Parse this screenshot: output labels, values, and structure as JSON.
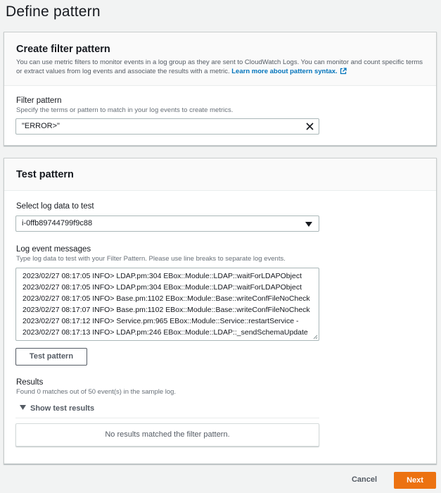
{
  "page": {
    "title": "Define pattern"
  },
  "create_panel": {
    "title": "Create filter pattern",
    "description": "You can use metric filters to monitor events in a log group as they are sent to CloudWatch Logs. You can monitor and count specific terms or extract values from log events and associate the results with a metric.",
    "learn_more": "Learn more about pattern syntax.",
    "filter_label": "Filter pattern",
    "filter_desc": "Specify the terms or pattern to match in your log events to create metrics.",
    "filter_value": "\"ERROR>\""
  },
  "test_panel": {
    "title": "Test pattern",
    "select_label": "Select log data to test",
    "select_value": "i-0ffb89744799f9c88",
    "messages_label": "Log event messages",
    "messages_desc": "Type log data to test with your Filter Pattern. Please use line breaks to separate log events.",
    "log_lines": [
      "2023/02/27 08:17:05 INFO> LDAP.pm:304 EBox::Module::LDAP::waitForLDAPObject",
      "2023/02/27 08:17:05 INFO> LDAP.pm:304 EBox::Module::LDAP::waitForLDAPObject",
      "2023/02/27 08:17:05 INFO> Base.pm:1102 EBox::Module::Base::writeConfFileNoCheck",
      "2023/02/27 08:17:07 INFO> Base.pm:1102 EBox::Module::Base::writeConfFileNoCheck",
      "2023/02/27 08:17:12 INFO> Service.pm:965 EBox::Module::Service::restartService -",
      "2023/02/27 08:17:13 INFO> LDAP.pm:246 EBox::Module::LDAP::_sendSchemaUpdate"
    ],
    "test_button": "Test pattern",
    "results_label": "Results",
    "results_desc": "Found 0 matches out of 50 event(s) in the sample log.",
    "show_results": "Show test results",
    "no_results": "No results matched the filter pattern."
  },
  "footer": {
    "cancel": "Cancel",
    "next": "Next"
  },
  "colors": {
    "primary": "#ec7211",
    "link": "#0073bb",
    "text": "#16191f",
    "secondary_text": "#545b64"
  }
}
